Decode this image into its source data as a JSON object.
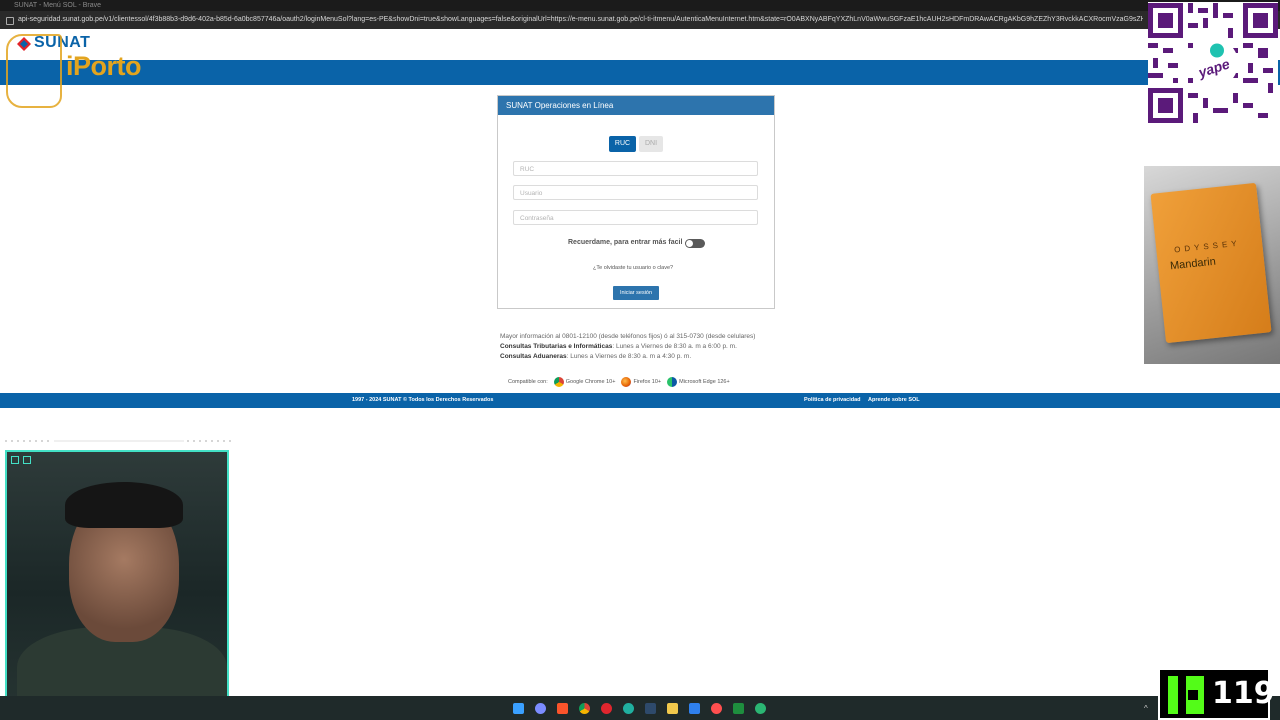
{
  "browser": {
    "title": "SUNAT - Menú SOL - Brave",
    "url": "api-seguridad.sunat.gob.pe/v1/clientessol/4f3b88b3-d9d6-402a-b85d-6a0bc857746a/oauth2/loginMenuSol?lang=es-PE&showDni=true&showLanguages=false&originalUrl=https://e-menu.sunat.gob.pe/cl-ti-itmenu/AutenticaMenuInternet.htm&state=rO0ABXNyABFqYXZhLnV0aWwuSGFzaE1hcAUH2sHDFmDRAwACRgAKbG9hZEZhY3RvckkACXRocmVzaG9sZHhwP"
  },
  "header": {
    "logo_text": "SUNAT",
    "overlay_brand": "iPorto"
  },
  "login": {
    "panel_title": "SUNAT Operaciones en Línea",
    "tabs": [
      {
        "label": "RUC",
        "active": true
      },
      {
        "label": "DNI",
        "active": false
      }
    ],
    "placeholders": {
      "ruc": "RUC",
      "usuario": "Usuario",
      "contrasena": "Contraseña"
    },
    "remember_label": "Recuerdame, para entrar más facil",
    "forgot_link": "¿Te olvidaste tu usuario o clave?",
    "submit_label": "Iniciar sesión"
  },
  "info": {
    "phone_line": "Mayor información al 0801-12100 (desde teléfonos fijos) ó al 315-0730 (desde celulares)",
    "tributarias_label": "Consultas Tributarias e Informáticas",
    "tributarias_hours": ": Lunes a Viernes de 8:30 a. m a 6:00 p. m.",
    "aduaneras_label": "Consultas Aduaneras",
    "aduaneras_hours": ": Lunes a Viernes de 8:30 a. m a 4:30 p. m.",
    "compatible_label": "Compatible con:",
    "browsers": [
      "Google Chrome 10+",
      "Firefox 10+",
      "Microsoft Edge 126+"
    ]
  },
  "footer": {
    "copyright": "1997 - 2024 SUNAT © Todos los Derechos Reservados",
    "privacy_link": "Política de privacidad",
    "learn_link": "Aprende sobre SOL"
  },
  "overlays": {
    "qr_label": "yape",
    "perfume_brand": "ODYSSEY",
    "perfume_name": "Mandarin",
    "viewer_count": "119"
  },
  "colors": {
    "sunat_blue": "#0a63a8",
    "panel_blue": "#2d74ad",
    "iporto_gold": "#e3a41e",
    "webcam_border": "#43e0c6",
    "kick_green": "#53fc18"
  }
}
